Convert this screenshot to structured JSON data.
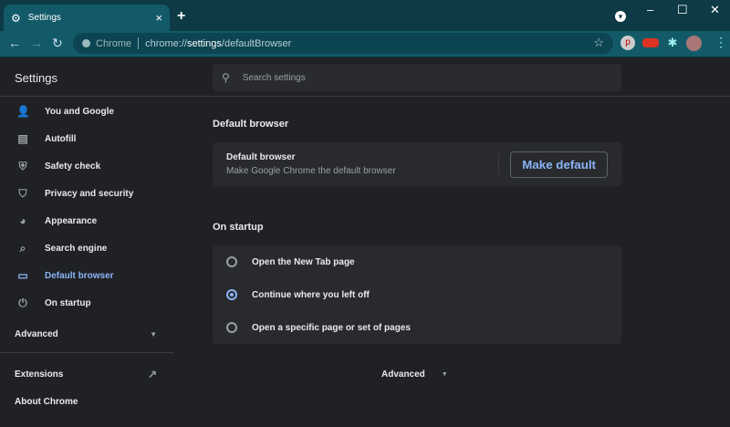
{
  "tab": {
    "title": "Settings",
    "close": "×",
    "new_tab": "+"
  },
  "window": {
    "minimize": "–",
    "maximize": "☐",
    "close": "✕",
    "profile_menu": "▾"
  },
  "toolbar": {
    "back": "←",
    "forward": "→",
    "reload": "↻",
    "chip": "Chrome",
    "url_scheme": "chrome://",
    "url_host": "settings",
    "url_path": "/defaultBrowser",
    "star": "☆",
    "menu": "⋮"
  },
  "header": {
    "title": "Settings",
    "search_placeholder": "Search settings"
  },
  "sidebar": {
    "items": [
      {
        "label": "You and Google",
        "icon": "person-icon",
        "glyph": "👤"
      },
      {
        "label": "Autofill",
        "icon": "clipboard-icon",
        "glyph": "▤"
      },
      {
        "label": "Safety check",
        "icon": "shield-check-icon",
        "glyph": "⛨"
      },
      {
        "label": "Privacy and security",
        "icon": "shield-icon",
        "glyph": "⛉"
      },
      {
        "label": "Appearance",
        "icon": "palette-icon",
        "glyph": "◕"
      },
      {
        "label": "Search engine",
        "icon": "search-icon",
        "glyph": "⌕"
      },
      {
        "label": "Default browser",
        "icon": "browser-icon",
        "glyph": "▭"
      },
      {
        "label": "On startup",
        "icon": "power-icon",
        "glyph": "⏻"
      }
    ],
    "advanced": "Advanced",
    "extensions": "Extensions",
    "about": "About Chrome"
  },
  "main": {
    "default_browser": {
      "section": "Default browser",
      "title": "Default browser",
      "subtitle": "Make Google Chrome the default browser",
      "button": "Make default"
    },
    "on_startup": {
      "section": "On startup",
      "options": [
        "Open the New Tab page",
        "Continue where you left off",
        "Open a specific page or set of pages"
      ],
      "selected": 1
    },
    "advanced": "Advanced"
  },
  "colors": {
    "accent": "#8ab4f8",
    "tabstrip": "#0d3a45",
    "toolbar": "#135a69"
  }
}
